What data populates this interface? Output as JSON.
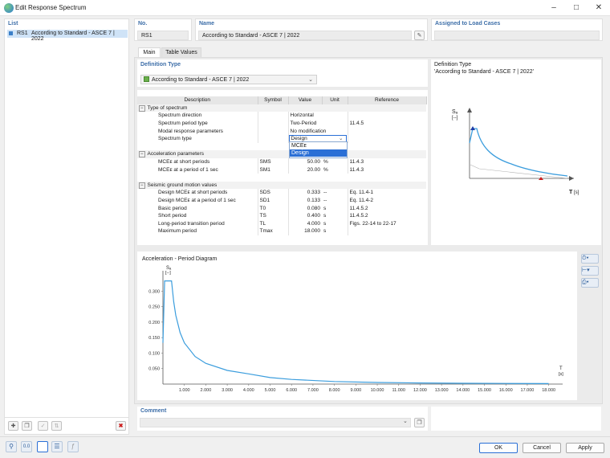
{
  "window": {
    "title": "Edit Response Spectrum"
  },
  "list": {
    "header": "List",
    "items": [
      {
        "id": "RS1",
        "label": "According to Standard - ASCE 7 | 2022"
      }
    ]
  },
  "no": {
    "header": "No.",
    "value": "RS1"
  },
  "name": {
    "header": "Name",
    "value": "According to Standard - ASCE 7 | 2022"
  },
  "assigned": {
    "header": "Assigned to Load Cases",
    "value": ""
  },
  "tabs": [
    {
      "label": "Main"
    },
    {
      "label": "Table Values"
    }
  ],
  "definition_type": {
    "header": "Definition Type",
    "value": "According to Standard - ASCE 7 | 2022"
  },
  "preview": {
    "title": "Definition Type",
    "subtitle": "'According to Standard - ASCE 7 | 2022'",
    "s_label": "Sₐ",
    "s_unit": "[--]",
    "t_label": "T",
    "t_unit": "[s]"
  },
  "table": {
    "columns": [
      "Description",
      "Symbol",
      "Value",
      "Unit",
      "Reference"
    ],
    "groups": [
      {
        "title": "Type of spectrum",
        "rows": [
          {
            "description": "Spectrum direction",
            "symbol": "",
            "value": "Horizontal",
            "unit": "",
            "reference": ""
          },
          {
            "description": "Spectrum period type",
            "symbol": "",
            "value": "Two-Period",
            "unit": "",
            "reference": "11.4.5"
          },
          {
            "description": "Modal response parameters",
            "symbol": "",
            "value": "No modification",
            "unit": "",
            "reference": ""
          },
          {
            "description": "Spectrum type",
            "symbol": "",
            "value": "Design",
            "unit": "",
            "reference": ""
          }
        ]
      },
      {
        "title": "Acceleration parameters",
        "rows": [
          {
            "description": "MCEᴇ at short periods",
            "symbol": "SMS",
            "value": "50.00",
            "unit": "%",
            "reference": "11.4.3"
          },
          {
            "description": "MCEᴇ at a period of 1 sec",
            "symbol": "SM1",
            "value": "20.00",
            "unit": "%",
            "reference": "11.4.3"
          }
        ]
      },
      {
        "title": "Seismic ground motion values",
        "rows": [
          {
            "description": "Design MCEᴇ at short periods",
            "symbol": "SDS",
            "value": "0.333",
            "unit": "--",
            "reference": "Eq. 11.4-1"
          },
          {
            "description": "Design MCEᴇ at a period of 1 sec",
            "symbol": "SD1",
            "value": "0.133",
            "unit": "--",
            "reference": "Eq. 11.4-2"
          },
          {
            "description": "Basic period",
            "symbol": "T0",
            "value": "0.080",
            "unit": "s",
            "reference": "11.4.5.2"
          },
          {
            "description": "Short period",
            "symbol": "TS",
            "value": "0.400",
            "unit": "s",
            "reference": "11.4.5.2"
          },
          {
            "description": "Long-period transition period",
            "symbol": "TL",
            "value": "4.000",
            "unit": "s",
            "reference": "Figs. 22-14 to 22-17"
          },
          {
            "description": "Maximum period",
            "symbol": "Tmax",
            "value": "18.000",
            "unit": "s",
            "reference": ""
          }
        ]
      }
    ],
    "spectrum_type_options": [
      "MCEᴇ",
      "Design"
    ],
    "spectrum_type_selected": "Design"
  },
  "diagram": {
    "title": "Acceleration - Period Diagram",
    "y_label": "Sₐ",
    "y_unit": "[--]",
    "x_label": "T",
    "x_unit": "[s]"
  },
  "chart_data": {
    "type": "line",
    "title": "Acceleration - Period Diagram",
    "xlabel": "T [s]",
    "ylabel": "Sa [--]",
    "xlim": [
      0,
      18.5
    ],
    "ylim": [
      0,
      0.35
    ],
    "xticks": [
      "1.000",
      "2.000",
      "3.000",
      "4.000",
      "5.000",
      "6.000",
      "7.000",
      "8.000",
      "9.000",
      "10.000",
      "11.000",
      "12.000",
      "13.000",
      "14.000",
      "15.000",
      "16.000",
      "17.000",
      "18.000"
    ],
    "yticks": [
      "0.050",
      "0.100",
      "0.150",
      "0.200",
      "0.250",
      "0.300"
    ],
    "series": [
      {
        "x": [
          0,
          0.08,
          0.4,
          0.5,
          0.6,
          0.8,
          1.0,
          1.5,
          2.0,
          3.0,
          4.0,
          5.0,
          6.0,
          8.0,
          10.0,
          12.0,
          14.0,
          16.0,
          18.0
        ],
        "y": [
          0.133,
          0.333,
          0.333,
          0.266,
          0.222,
          0.166,
          0.133,
          0.089,
          0.067,
          0.044,
          0.033,
          0.021,
          0.015,
          0.0083,
          0.0053,
          0.0037,
          0.0027,
          0.0021,
          0.0016
        ]
      }
    ]
  },
  "comment": {
    "header": "Comment",
    "value": ""
  },
  "buttons": {
    "ok": "OK",
    "cancel": "Cancel",
    "apply": "Apply"
  },
  "colors": {
    "curve": "#3b9ddd",
    "accent": "#2a6fd6",
    "header": "#3d6ea8",
    "selection": "#2a6fd6",
    "delete": "#cc1f1f"
  }
}
